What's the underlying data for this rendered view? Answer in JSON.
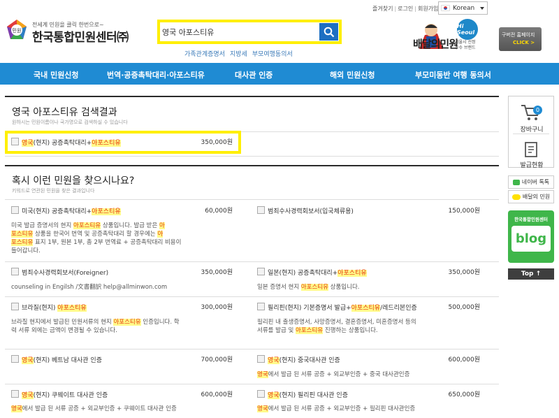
{
  "header": {
    "top_links": [
      "즐겨찾기",
      "로그인",
      "회원가입"
    ],
    "language": "Korean",
    "logo_tagline": "전세계 민원을 클릭 한번으로~",
    "logo_badge": "민원",
    "logo_text": "한국통합민원센터㈜",
    "search_value": "영국 아포스티유",
    "quick_links": [
      "가족관계증명서",
      "지방세",
      "부모여행동의서"
    ],
    "baedal_title": "배달의민원",
    "hiseoul": "Hi Seoul",
    "hiseoul_caption": [
      "서울시 선정",
      "우수 브랜드"
    ],
    "promo_text": "구버전 홈페이지",
    "promo_click": "CLICK >"
  },
  "nav": {
    "items": [
      "국내 민원신청",
      "번역·공증촉탁대리·아포스티유",
      "대사관 인증",
      "해외 민원신청",
      "부모미동반 여행 동의서"
    ]
  },
  "results": {
    "title": "영국 아포스티유 검색결과",
    "subtitle": "원하시는 민원이름이나 국가명으로 검색하실 수 있습니다",
    "item": {
      "name_pre": "영국",
      "name_mid": "(현지) 공증촉탁대리+",
      "name_kw": "아포스티유",
      "price": "350,000원"
    }
  },
  "suggest": {
    "title": "혹시 이런 민원을 찾으시나요?",
    "subtitle": "키워드로 연관된 민원을 찾은 결과입니다",
    "items": [
      {
        "name_pre": "미국(현지) 공증촉탁대리+",
        "name_kw": "아포스티유",
        "price": "60,000원",
        "desc": [
          "미국 발급 증명서의 현지 ",
          "아포스티유",
          " 상품입니다. 발급 받은 ",
          "아",
          "포스티유",
          " 상품을 한국어 번역 및 공증촉탁대리 할 경우에는 ",
          "아",
          "포스티유",
          " 표지 1부, 원본 1부, 총 2부 번역료 + 공증촉탁대리 비용이 들어갑니다."
        ]
      },
      {
        "name_pre": "범죄수사경력회보서(입국체류용)",
        "name_kw": "",
        "price": "150,000원",
        "desc": []
      },
      {
        "name_pre": "범죄수사경력회보서(Foreigner)",
        "name_kw": "",
        "price": "350,000원",
        "desc": [
          "counseling in Engilsh /文書翻訳 help@allminwon.com"
        ]
      },
      {
        "name_pre": "일본(현지) 공증촉탁대리+",
        "name_kw": "아포스티유",
        "price": "350,000원",
        "desc": [
          "일본 증명서 현지 ",
          "아포스티유",
          " 상품입니다."
        ]
      },
      {
        "name_pre": "브라질(현지) ",
        "name_kw": "아포스티유",
        "price": "300,000원",
        "desc": [
          "브라질 현지에서 발급된 민원서류의 현지 ",
          "아포스티유",
          " 인증입니다. 학력 서류 외에는 금액이 변경될 수 있습니다."
        ]
      },
      {
        "name_pre": "필리핀(현지) 기본증명서 발급+",
        "name_kw": "아포스티유",
        "name_post": "/레드리본인증",
        "price": "500,000원",
        "desc": [
          "필리핀 내 출생증명서, 사망증명서, 결혼증명서, 미혼증명서 등의",
          "서류를 발급 및 ",
          "아포스티유",
          " 진행하는 상품입니다."
        ]
      },
      {
        "name_pre": "영국",
        "name_mid": "(현지) 베트남 대사관 인증",
        "name_kw": "",
        "price": "700,000원",
        "desc": []
      },
      {
        "name_pre": "영국",
        "name_mid": "(현지) 중국대사관 인증",
        "name_kw": "",
        "price": "600,000원",
        "desc": [
          "영국",
          "에서 발급 된 서류 공증 + 외교부인증 + 중국 대사관인증"
        ]
      },
      {
        "name_pre": "영국",
        "name_mid": "(현지) 쿠웨이트 대사관 인증",
        "name_kw": "",
        "price": "600,000원",
        "desc": [
          "영국",
          "에서 발급 된 서류 공증 + 외교부인증 + 쿠웨이트 대사관 인증"
        ]
      },
      {
        "name_pre": "영국",
        "name_mid": "(현지) 필리핀 대사관 인증",
        "name_kw": "",
        "price": "650,000원",
        "desc": [
          "영국",
          "에서 발급 된 서류 공증 + 외교부인증 + 필리핀 대사관인증"
        ]
      }
    ]
  },
  "sidebar": {
    "cart_label": "장바구니",
    "cart_count": "0",
    "status_label": "발급현황",
    "naver_label": "네이버 톡톡",
    "kakao_label": "배달의 민원",
    "blog_caption": "한국통합민원센터",
    "blog_word": "blog",
    "top_label": "Top ↑"
  },
  "colors": {
    "nav": "#1f8bd3",
    "highlight": "#ffef00",
    "keyword": "#e8380d",
    "blog": "#3fb64a"
  }
}
